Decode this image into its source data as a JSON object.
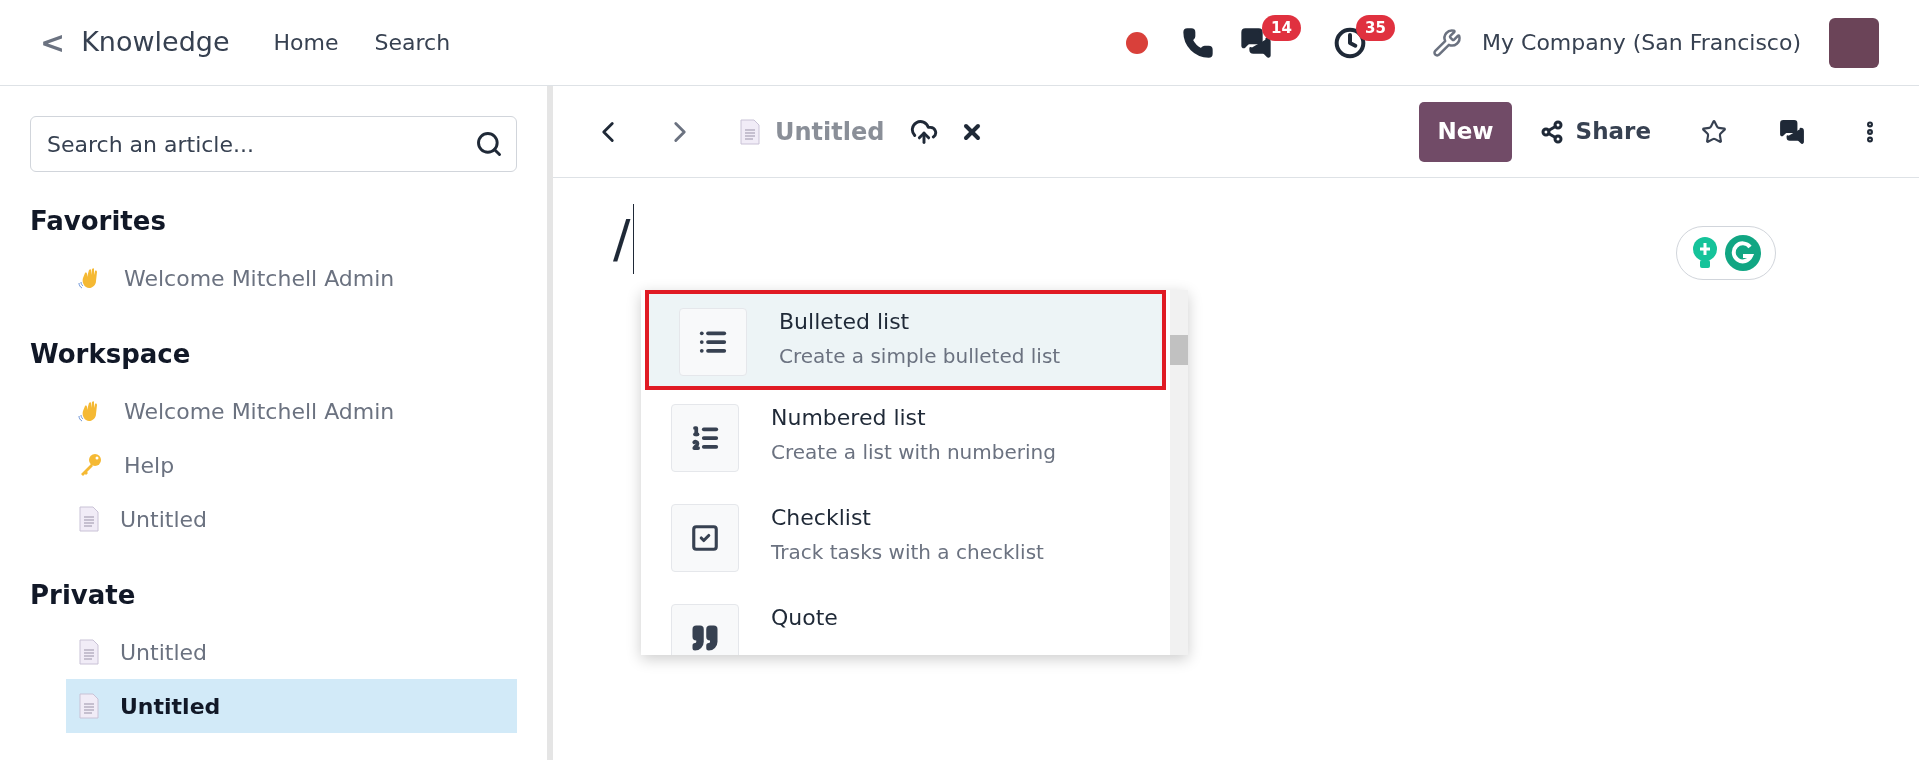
{
  "topbar": {
    "back": "<",
    "app_title": "Knowledge",
    "menu": [
      "Home",
      "Search"
    ],
    "messages_count": "14",
    "activities_count": "35",
    "company": "My Company (San Francisco)"
  },
  "sidebar": {
    "search": {
      "placeholder": "Search an article..."
    },
    "sections": [
      {
        "title": "Favorites",
        "items": [
          {
            "kind": "wave",
            "label": "Welcome Mitchell Admin",
            "selected": false
          }
        ]
      },
      {
        "title": "Workspace",
        "items": [
          {
            "kind": "wave",
            "label": "Welcome Mitchell Admin",
            "selected": false
          },
          {
            "kind": "key",
            "label": "Help",
            "selected": false
          },
          {
            "kind": "page",
            "label": "Untitled",
            "selected": false
          }
        ]
      },
      {
        "title": "Private",
        "items": [
          {
            "kind": "page",
            "label": "Untitled",
            "selected": false
          },
          {
            "kind": "page",
            "label": "Untitled",
            "selected": true
          }
        ]
      }
    ]
  },
  "toolbar": {
    "article_title": "Untitled",
    "new_button": "New",
    "share_button": "Share"
  },
  "editor": {
    "typed": "/"
  },
  "command_menu": [
    {
      "kind": "bullets",
      "title": "Bulleted list",
      "description": "Create a simple bulleted list",
      "selected": true
    },
    {
      "kind": "numbers",
      "title": "Numbered list",
      "description": "Create a list with numbering",
      "selected": false
    },
    {
      "kind": "check",
      "title": "Checklist",
      "description": "Track tasks with a checklist",
      "selected": false
    },
    {
      "kind": "quote",
      "title": "Quote",
      "selected": false
    }
  ]
}
